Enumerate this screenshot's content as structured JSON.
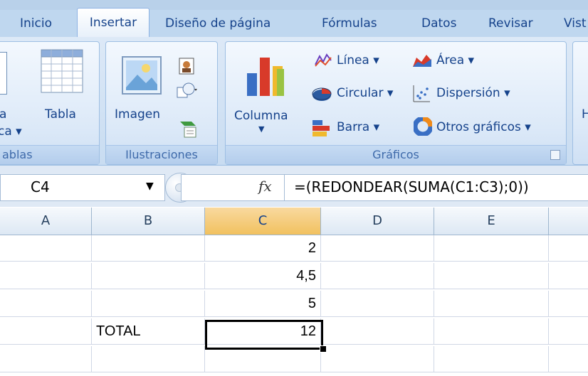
{
  "tabs": [
    {
      "label": "Inicio"
    },
    {
      "label": "Insertar"
    },
    {
      "label": "Diseño de página"
    },
    {
      "label": "Fórmulas"
    },
    {
      "label": "Datos"
    },
    {
      "label": "Revisar"
    },
    {
      "label": "Vist"
    }
  ],
  "ribbon": {
    "tablas": {
      "label": "Tablas",
      "label_visible": "ablas",
      "tabla": "Tabla",
      "partial_top": "a",
      "partial_bottom": "ca ▾"
    },
    "ilustraciones": {
      "label": "Ilustraciones",
      "imagen": "Imagen"
    },
    "graficos": {
      "label": "Gráficos",
      "columna": "Columna",
      "linea": "Línea ▾",
      "circular": "Circular ▾",
      "barra": "Barra ▾",
      "area": "Área ▾",
      "dispersion": "Dispersión ▾",
      "otros": "Otros gráficos ▾"
    },
    "next_partial": "H"
  },
  "formula_bar": {
    "name_box": "C4",
    "fx": "fx",
    "formula": "=(REDONDEAR(SUMA(C1:C3);0))"
  },
  "grid": {
    "columns": [
      "A",
      "B",
      "C",
      "D",
      "E"
    ],
    "rows": [
      {
        "B": "",
        "C": "2"
      },
      {
        "B": "",
        "C": "4,5"
      },
      {
        "B": "",
        "C": "5"
      },
      {
        "B": "TOTAL",
        "C": "12"
      },
      {
        "B": "",
        "C": ""
      }
    ]
  },
  "colors": {
    "selected_header": "#f1c15f",
    "tab_text": "#15428b"
  }
}
